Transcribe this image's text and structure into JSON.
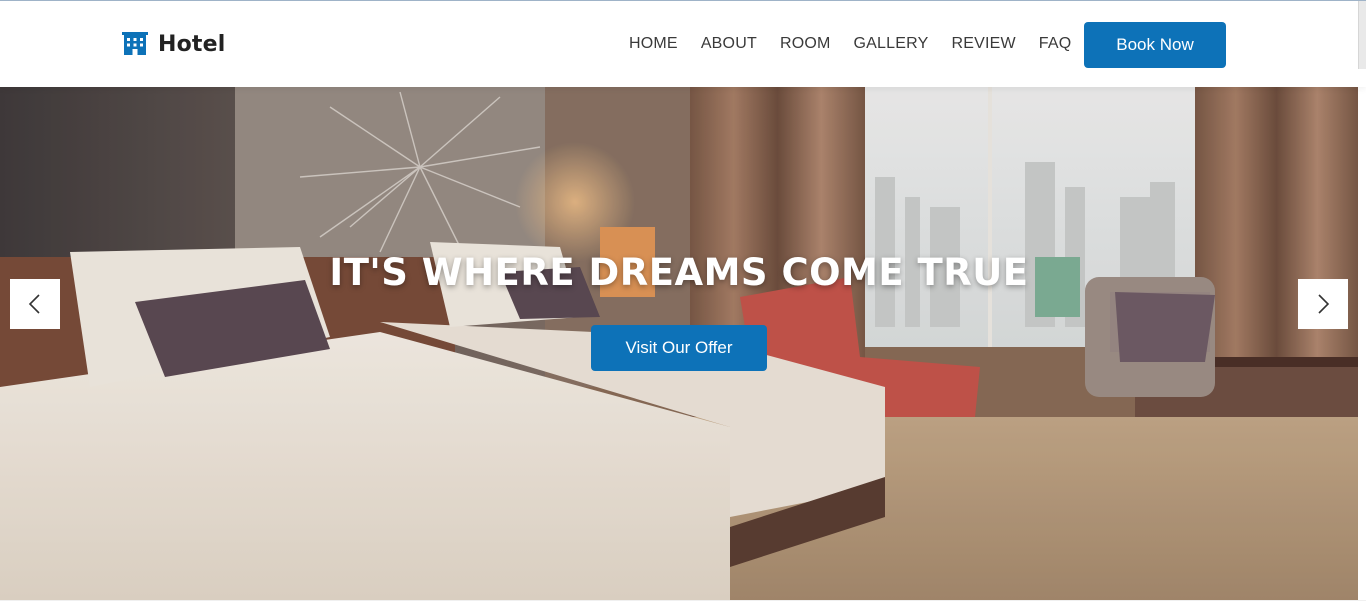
{
  "brand": {
    "name": "Hotel",
    "icon": "hotel-building-icon"
  },
  "nav": {
    "items": [
      "HOME",
      "ABOUT",
      "ROOM",
      "GALLERY",
      "REVIEW",
      "FAQ"
    ]
  },
  "header": {
    "book_label": "Book Now"
  },
  "hero": {
    "title": "IT'S WHERE DREAMS COME TRUE",
    "cta_label": "Visit Our Offer",
    "prev_icon": "chevron-left-icon",
    "next_icon": "chevron-right-icon"
  },
  "colors": {
    "accent": "#0d72b8",
    "text_dark": "#222222",
    "nav_text": "#3a3a3a"
  }
}
